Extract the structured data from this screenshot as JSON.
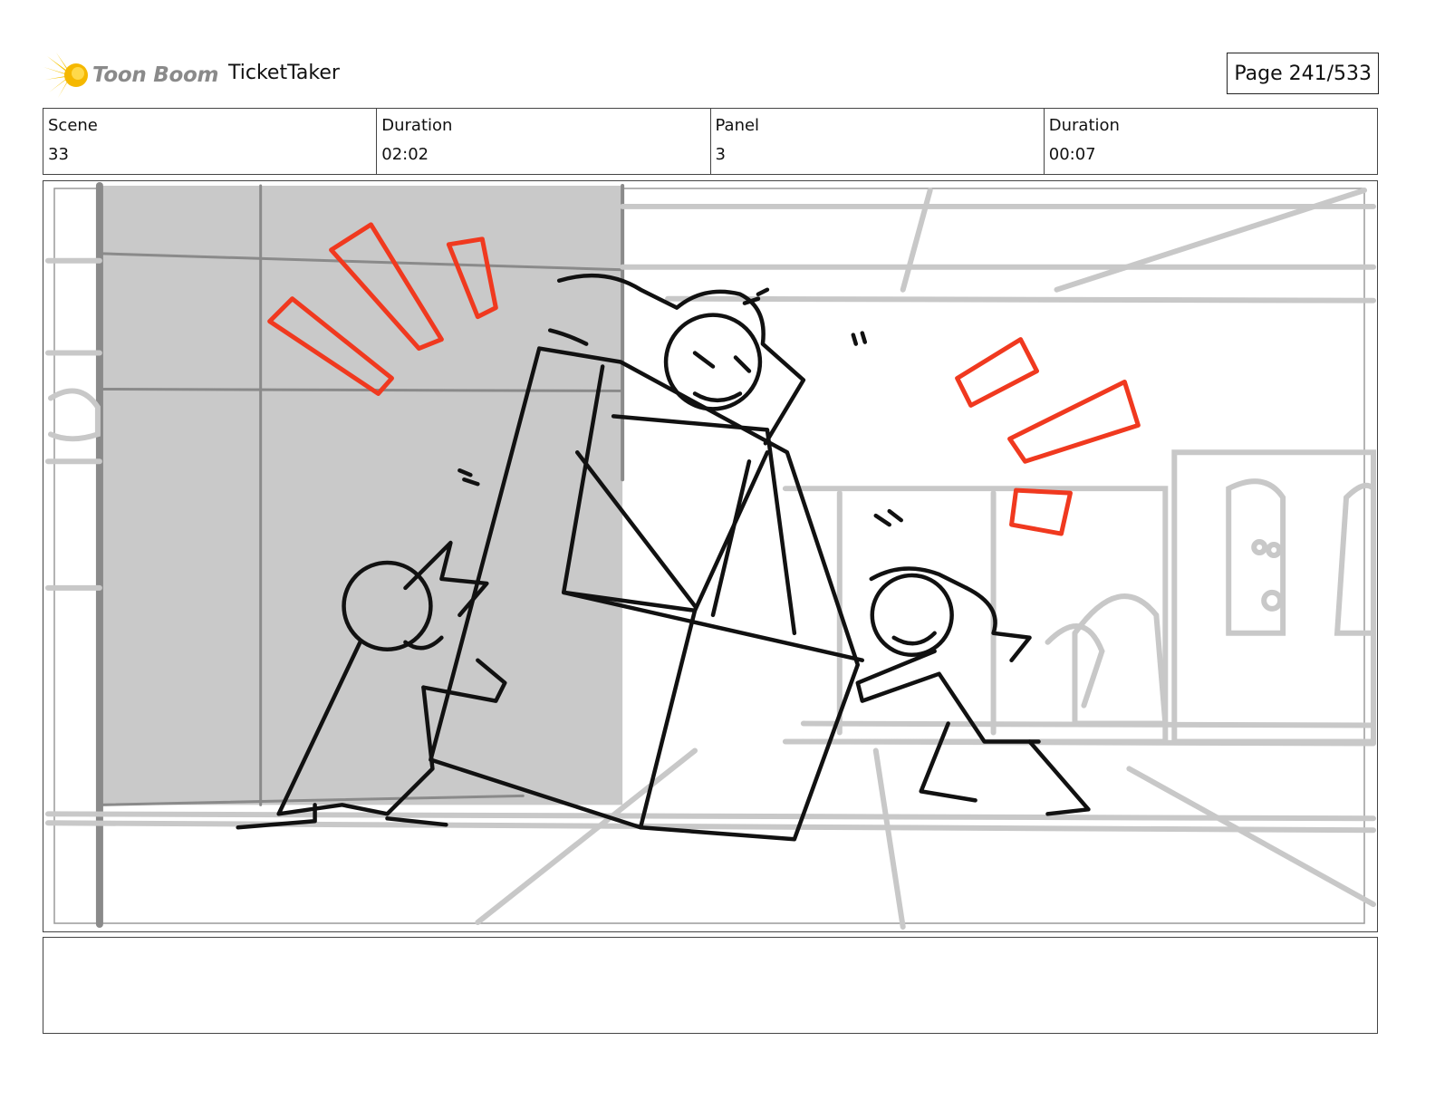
{
  "header": {
    "logo_text": "Toon Boom",
    "project_title": "TicketTaker",
    "page_label": "Page 241/533"
  },
  "info": {
    "scene_label": "Scene",
    "scene_value": "33",
    "scene_duration_label": "Duration",
    "scene_duration_value": "02:02",
    "panel_label": "Panel",
    "panel_value": "3",
    "panel_duration_label": "Duration",
    "panel_duration_value": "00:07"
  },
  "notes": {
    "text": ""
  },
  "colors": {
    "accent_red": "#f0391f",
    "logo_yellow": "#f5c400",
    "logo_grey": "#8a8a8a"
  }
}
